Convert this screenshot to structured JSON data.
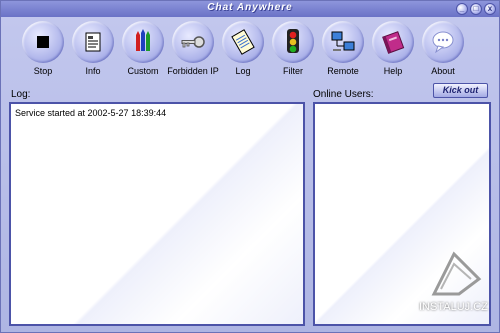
{
  "app": {
    "title": "Chat Anywhere"
  },
  "window_buttons": {
    "minimize": "_",
    "maximize": "□",
    "close": "x"
  },
  "toolbar": [
    {
      "key": "stop",
      "label": "Stop",
      "icon": "stop-icon"
    },
    {
      "key": "info",
      "label": "Info",
      "icon": "info-document-icon"
    },
    {
      "key": "custom",
      "label": "Custom",
      "icon": "crayons-icon"
    },
    {
      "key": "forbidden_ip",
      "label": "Forbidden IP",
      "icon": "key-icon"
    },
    {
      "key": "log",
      "label": "Log",
      "icon": "notepad-icon"
    },
    {
      "key": "filter",
      "label": "Filter",
      "icon": "traffic-light-icon"
    },
    {
      "key": "remote",
      "label": "Remote",
      "icon": "network-computers-icon"
    },
    {
      "key": "help",
      "label": "Help",
      "icon": "book-icon"
    },
    {
      "key": "about",
      "label": "About",
      "icon": "speech-bubble-icon"
    }
  ],
  "log_panel": {
    "label": "Log:",
    "lines": [
      "Service started at 2002-5-27 18:39:44"
    ]
  },
  "users_panel": {
    "label": "Online Users:",
    "kick_label": "Kick out",
    "users": []
  },
  "watermark": {
    "text": "INSTALUJ.CZ"
  }
}
